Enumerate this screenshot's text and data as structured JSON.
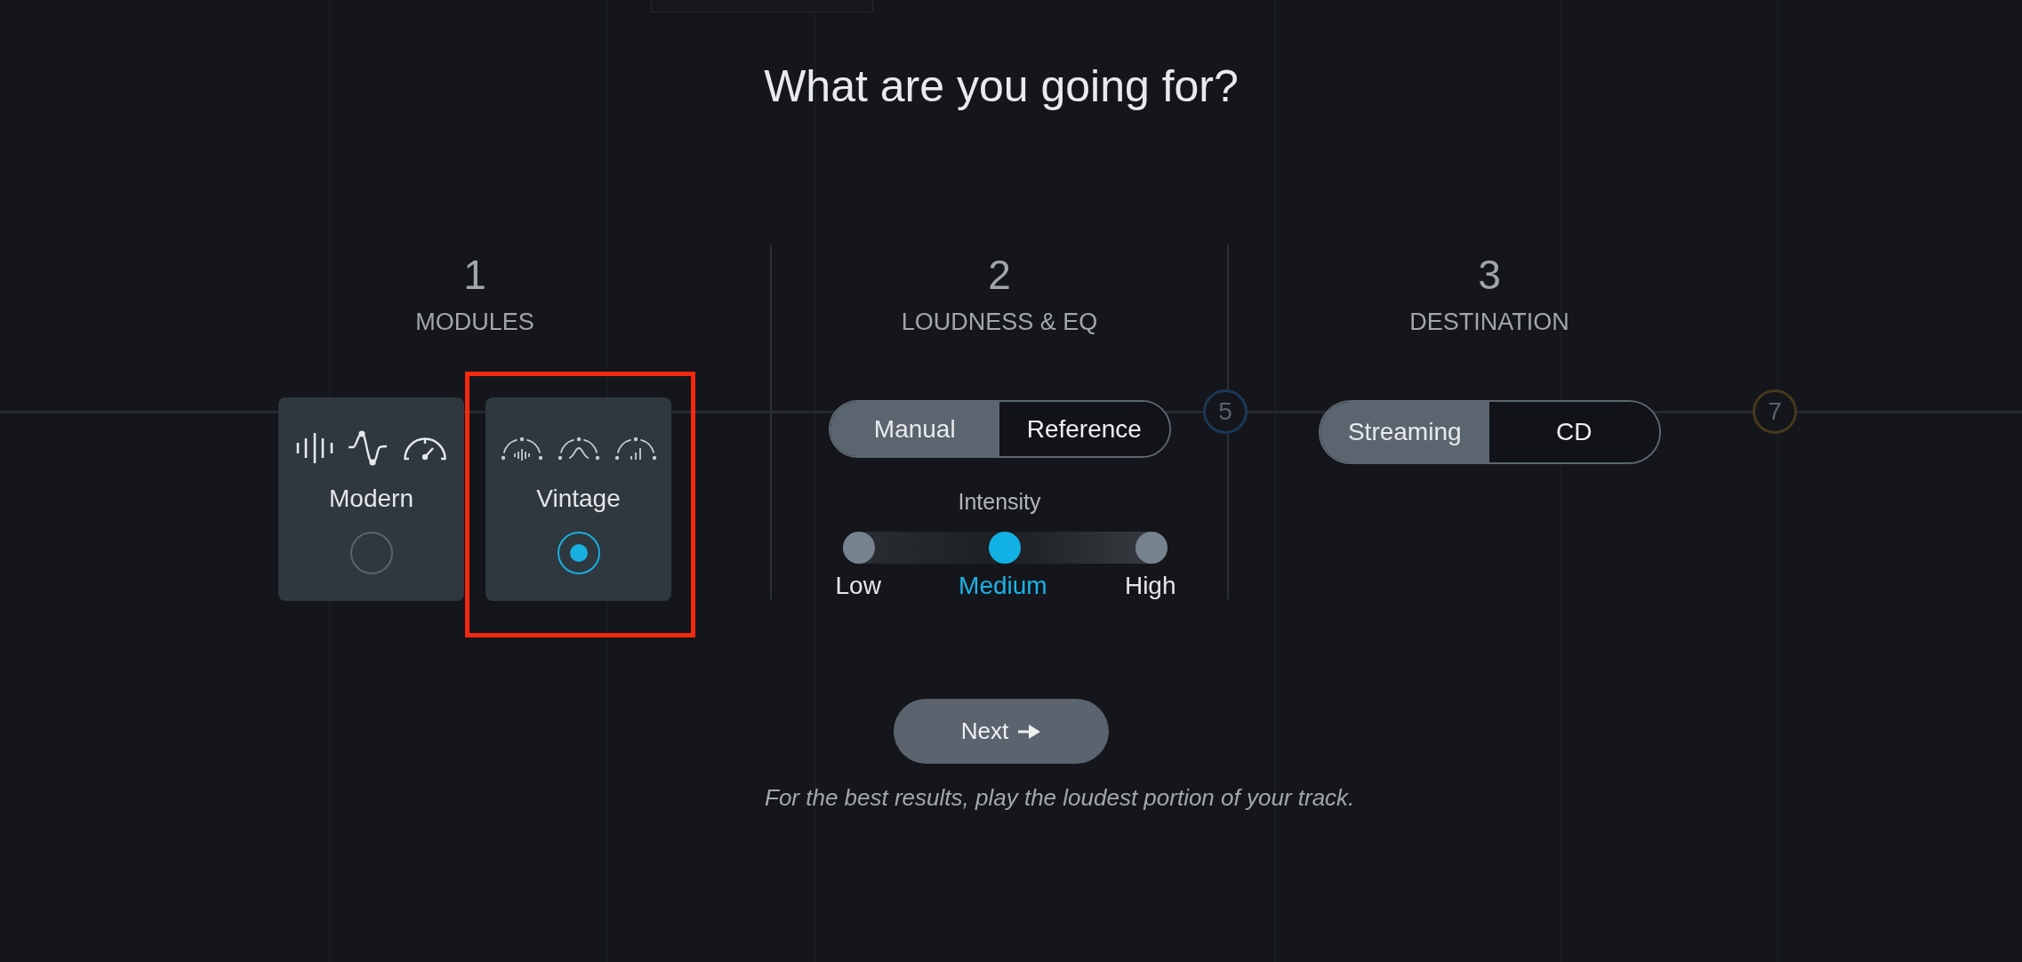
{
  "title": "What are you going for?",
  "background_markers": [
    {
      "label": "5",
      "color": "#1c3856"
    },
    {
      "label": "7",
      "color": "#46391d"
    }
  ],
  "steps": [
    {
      "number": "1",
      "heading": "MODULES",
      "kind": "cards",
      "cards": [
        {
          "label": "Modern",
          "kind": "modern",
          "selected": false,
          "highlighted": false
        },
        {
          "label": "Vintage",
          "kind": "vintage",
          "selected": true,
          "highlighted": true
        }
      ]
    },
    {
      "number": "2",
      "heading": "LOUDNESS & EQ",
      "kind": "toggle_slider",
      "toggle": [
        {
          "label": "Manual",
          "selected": true
        },
        {
          "label": "Reference",
          "selected": false
        }
      ],
      "slider": {
        "label": "Intensity",
        "stops": [
          {
            "label": "Low",
            "selected": false
          },
          {
            "label": "Medium",
            "selected": true
          },
          {
            "label": "High",
            "selected": false
          }
        ]
      }
    },
    {
      "number": "3",
      "heading": "DESTINATION",
      "kind": "toggle",
      "toggle": [
        {
          "label": "Streaming",
          "selected": true
        },
        {
          "label": "CD",
          "selected": false
        }
      ]
    }
  ],
  "next_button": {
    "label": "Next"
  },
  "hint": "For the best results, play the loudest portion of your track."
}
